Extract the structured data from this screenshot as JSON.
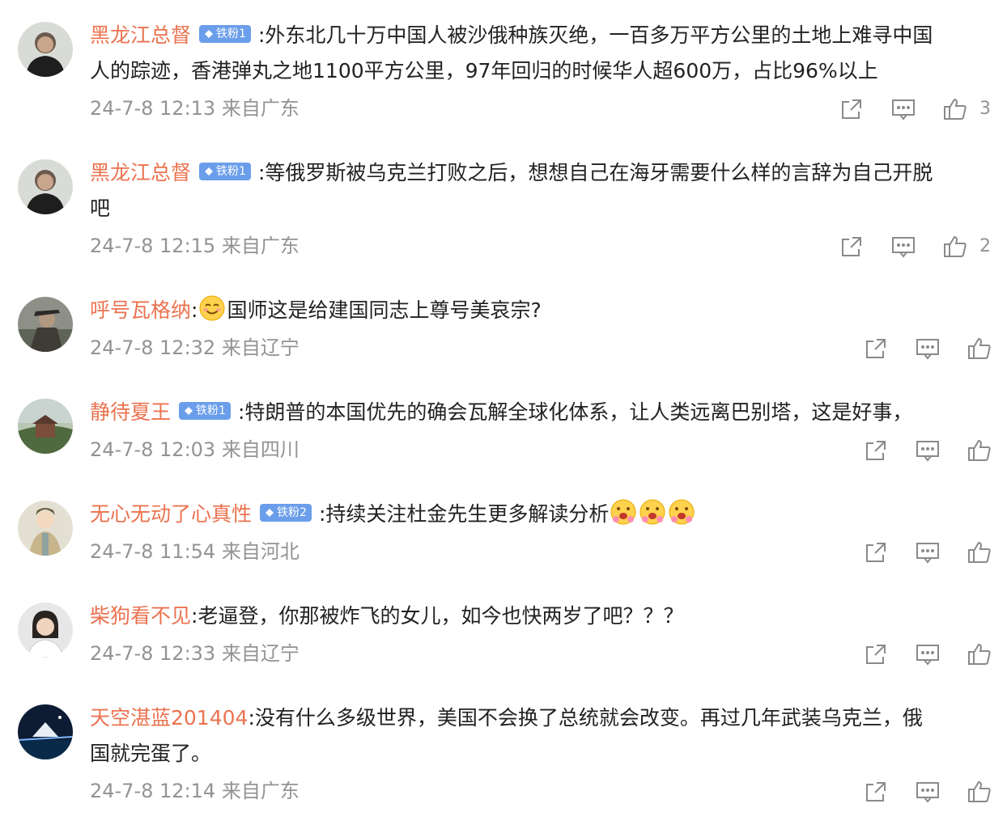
{
  "comments": [
    {
      "name": "黑龙江总督",
      "badge": "铁粉1",
      "line1": ":外东北几十万中国人被沙俄种族灭绝，一百多万平方公里的土地上难寻中国",
      "line2": "人的踪迹，香港弹丸之地1100平方公里，97年回归的时候华人超600万，占比96%以上",
      "meta": "24-7-8 12:13 来自广东",
      "likes": "3"
    },
    {
      "name": "黑龙江总督",
      "badge": "铁粉1",
      "line1": ":等俄罗斯被乌克兰打败之后，想想自己在海牙需要什么样的言辞为自己开脱",
      "line2": "吧",
      "meta": "24-7-8 12:15 来自广东",
      "likes": "2"
    },
    {
      "name": "呼号瓦格纳",
      "line1": ":",
      "line1b": "国师这是给建国同志上尊号美哀宗?",
      "meta": "24-7-8 12:32 来自辽宁"
    },
    {
      "name": "静待夏王",
      "badge": "铁粉1",
      "line1": ":特朗普的本国优先的确会瓦解全球化体系，让人类远离巴别塔，这是好事，",
      "meta": "24-7-8 12:03 来自四川"
    },
    {
      "name": "无心无动了心真性",
      "badge": "铁粉2",
      "line1": ":持续关注杜金先生更多解读分析",
      "meta": "24-7-8 11:54 来自河北"
    },
    {
      "name": "柴狗看不见",
      "line1": ":老逼登，你那被炸飞的女儿，如今也快两岁了吧？？？",
      "meta": "24-7-8 12:33 来自辽宁"
    },
    {
      "name": "天空湛蓝201404",
      "line1": ":没有什么多级世界，美国不会换了总统就会改变。再过几年武装乌克兰，俄",
      "line2": "国就完蛋了。",
      "meta": "24-7-8 12:14 来自广东"
    }
  ],
  "icons": {
    "share": "share-icon",
    "comment": "comment-icon",
    "like": "thumbs-up-icon",
    "badge": "diamond-icon",
    "emoji_smile": "smile-emoji-icon",
    "emoji_flower": "flower-face-emoji-icon"
  },
  "colors": {
    "username": "#eb7350",
    "meta_text": "#939393",
    "badge_bg": "#6b9eea",
    "icon_stroke": "#8a8a8a"
  }
}
